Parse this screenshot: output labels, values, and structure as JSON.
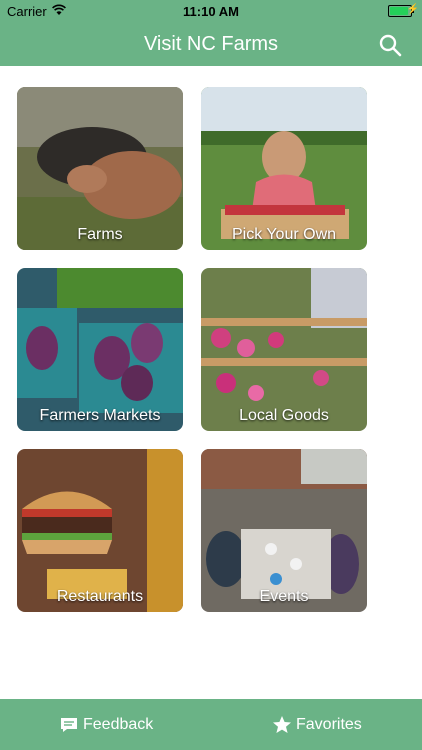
{
  "status": {
    "carrier": "Carrier",
    "time": "11:10 AM",
    "battery_level": 0.9
  },
  "header": {
    "title": "Visit NC Farms",
    "search_icon": "search-icon"
  },
  "tiles": [
    {
      "label": "Farms"
    },
    {
      "label": "Pick Your Own"
    },
    {
      "label": "Farmers Markets"
    },
    {
      "label": "Local Goods"
    },
    {
      "label": "Restaurants"
    },
    {
      "label": "Events"
    }
  ],
  "tabbar": {
    "feedback_label": "Feedback",
    "favorites_label": "Favorites"
  },
  "colors": {
    "brand": "#6ab386"
  }
}
